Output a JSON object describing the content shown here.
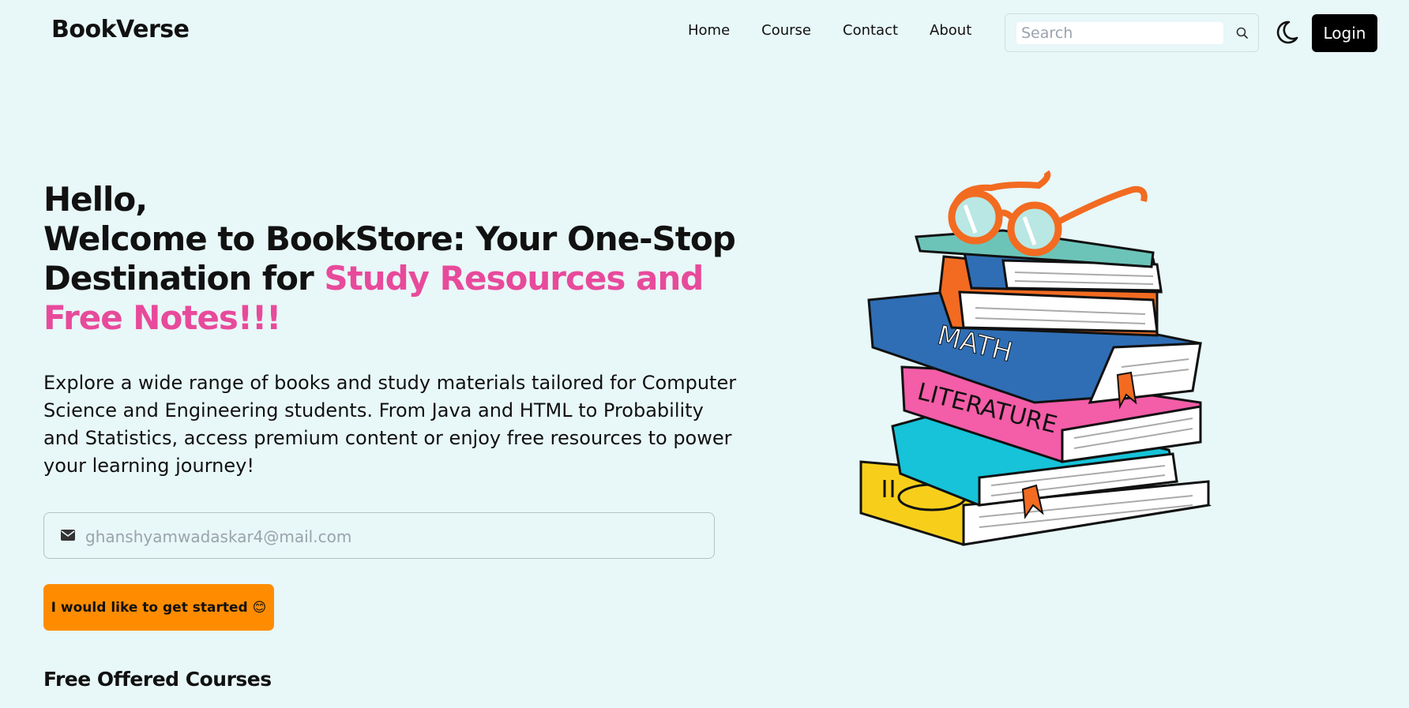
{
  "navbar": {
    "logo": "BookVerse",
    "links": [
      "Home",
      "Course",
      "Contact",
      "About"
    ],
    "search_placeholder": "Search",
    "login_label": "Login"
  },
  "hero": {
    "title_line1": "Hello,",
    "title_main": "Welcome to BookStore: Your One-Stop Destination for ",
    "title_accent": "Study Resources and Free Notes!!!",
    "description": "Explore a wide range of books and study materials tailored for Computer Science and Engineering students. From Java and HTML to Probability and Statistics, access premium content or enjoy free resources to power your learning journey!",
    "email_placeholder": "ghanshyamwadaskar4@mail.com",
    "cta_label": "I would like to get started 😊"
  },
  "courses": {
    "heading": "Free Offered Courses"
  },
  "illustration": {
    "book_labels": [
      "MATH",
      "LITERATURE"
    ]
  },
  "colors": {
    "background": "#e8f7f7",
    "accent_pink": "#e84a9b",
    "cta_orange": "#ff8c00",
    "login_bg": "#000000"
  },
  "icons": [
    "search-icon",
    "moon-icon",
    "mail-icon"
  ]
}
